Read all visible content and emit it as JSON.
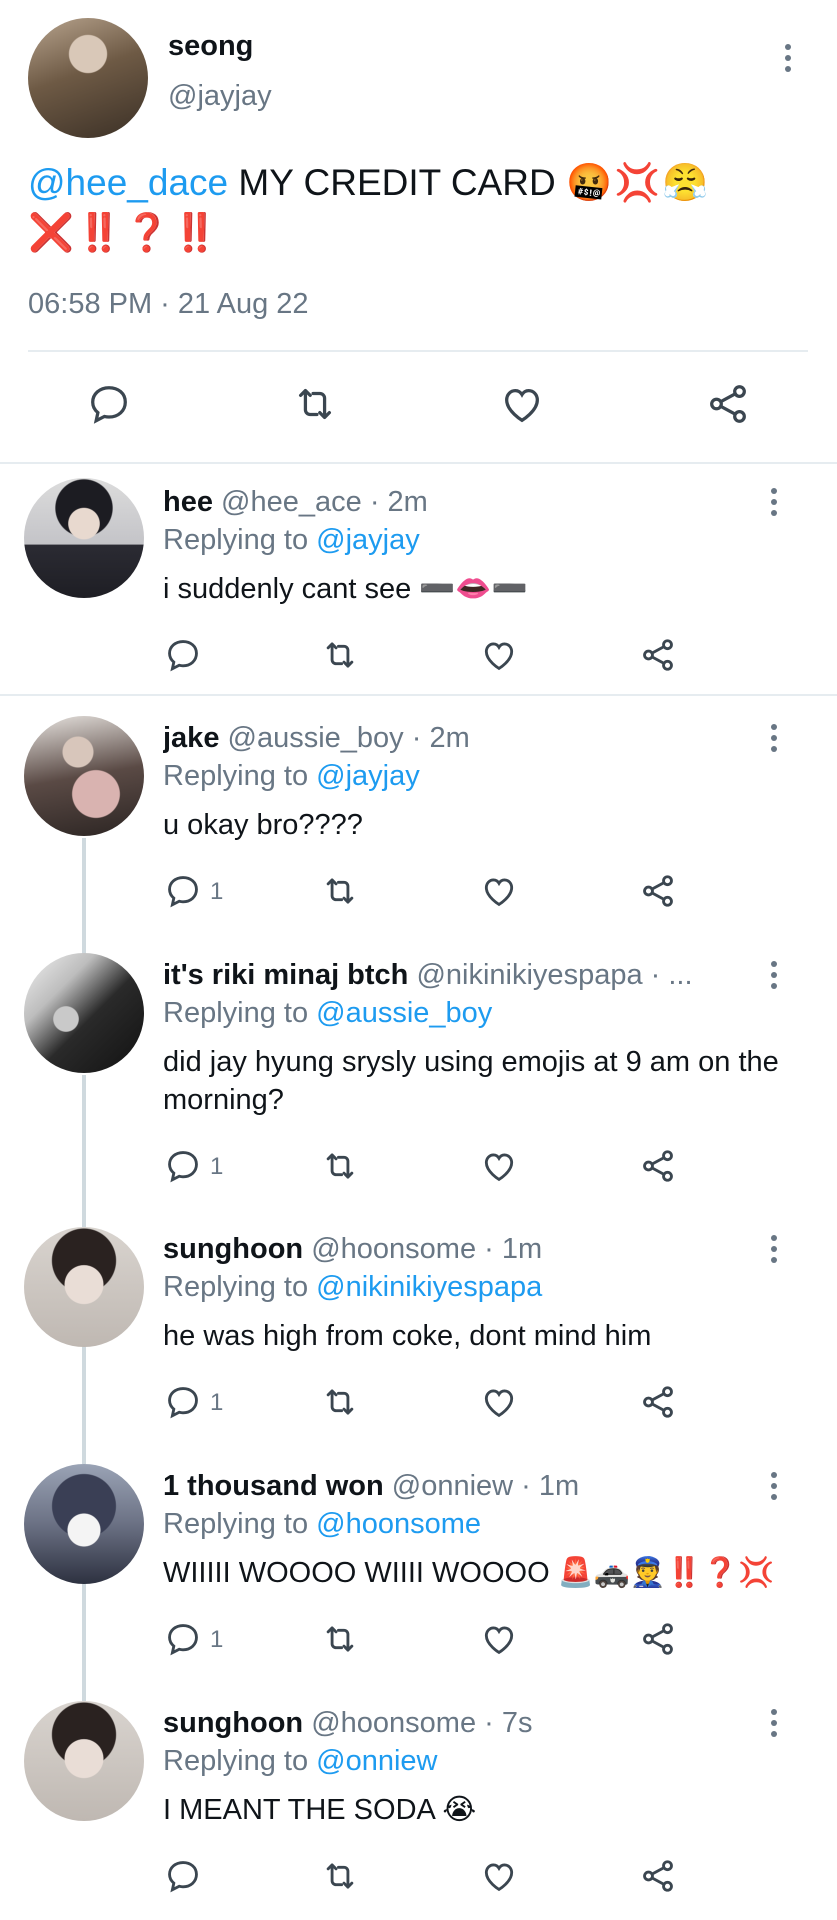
{
  "main_tweet": {
    "name": "seong",
    "handle": "@jayjay",
    "mention": "@hee_dace",
    "text": " MY CREDIT CARD ",
    "emoji_line1": "🤬💢😤",
    "emoji_line2": "❌‼️❓‼️",
    "timestamp": "06:58 PM · 21 Aug 22"
  },
  "replies": [
    {
      "name": "hee",
      "meta": "@hee_ace · 2m",
      "replying_label": "Replying to ",
      "replying_to": "@jayjay",
      "text": "i suddenly cant see ➖👄➖",
      "reply_count": "",
      "avatar_color": "#2b2b33"
    },
    {
      "name": "jake",
      "meta": "@aussie_boy · 2m",
      "replying_label": "Replying to ",
      "replying_to": "@jayjay",
      "text": "u okay bro????",
      "reply_count": "1",
      "avatar_color": "#4a3a36"
    },
    {
      "name": "it's riki minaj btch",
      "meta": "@nikinikiyespapa · ...",
      "replying_label": "Replying to ",
      "replying_to": "@aussie_boy",
      "text": "did jay hyung srysly using emojis at 9 am on the morning?",
      "reply_count": "1",
      "avatar_color": "#3a3a3a"
    },
    {
      "name": "sunghoon",
      "meta": "@hoonsome · 1m",
      "replying_label": "Replying to ",
      "replying_to": "@nikinikiyespapa",
      "text": "he was high from coke, dont mind him",
      "reply_count": "1",
      "avatar_color": "#c9c2bd"
    },
    {
      "name": "1 thousand won",
      "meta": "@onniew · 1m",
      "replying_label": "Replying to ",
      "replying_to": "@hoonsome",
      "text": "WIIIII WOOOO WIIII WOOOO 🚨🚓👮‼️❓💢",
      "reply_count": "1",
      "avatar_color": "#6b7184"
    },
    {
      "name": "sunghoon",
      "meta": "@hoonsome · 7s",
      "replying_label": "Replying to ",
      "replying_to": "@onniew",
      "text": "I MEANT THE SODA 😭",
      "reply_count": "",
      "avatar_color": "#c9c2bd"
    }
  ],
  "icons": {
    "reply": "reply-icon",
    "retweet": "retweet-icon",
    "like": "heart-icon",
    "share": "share-icon",
    "more": "more-options-icon"
  },
  "colors": {
    "mention": "#1d9bf0",
    "secondary_text": "#687684",
    "divider": "#e6ecf0"
  }
}
